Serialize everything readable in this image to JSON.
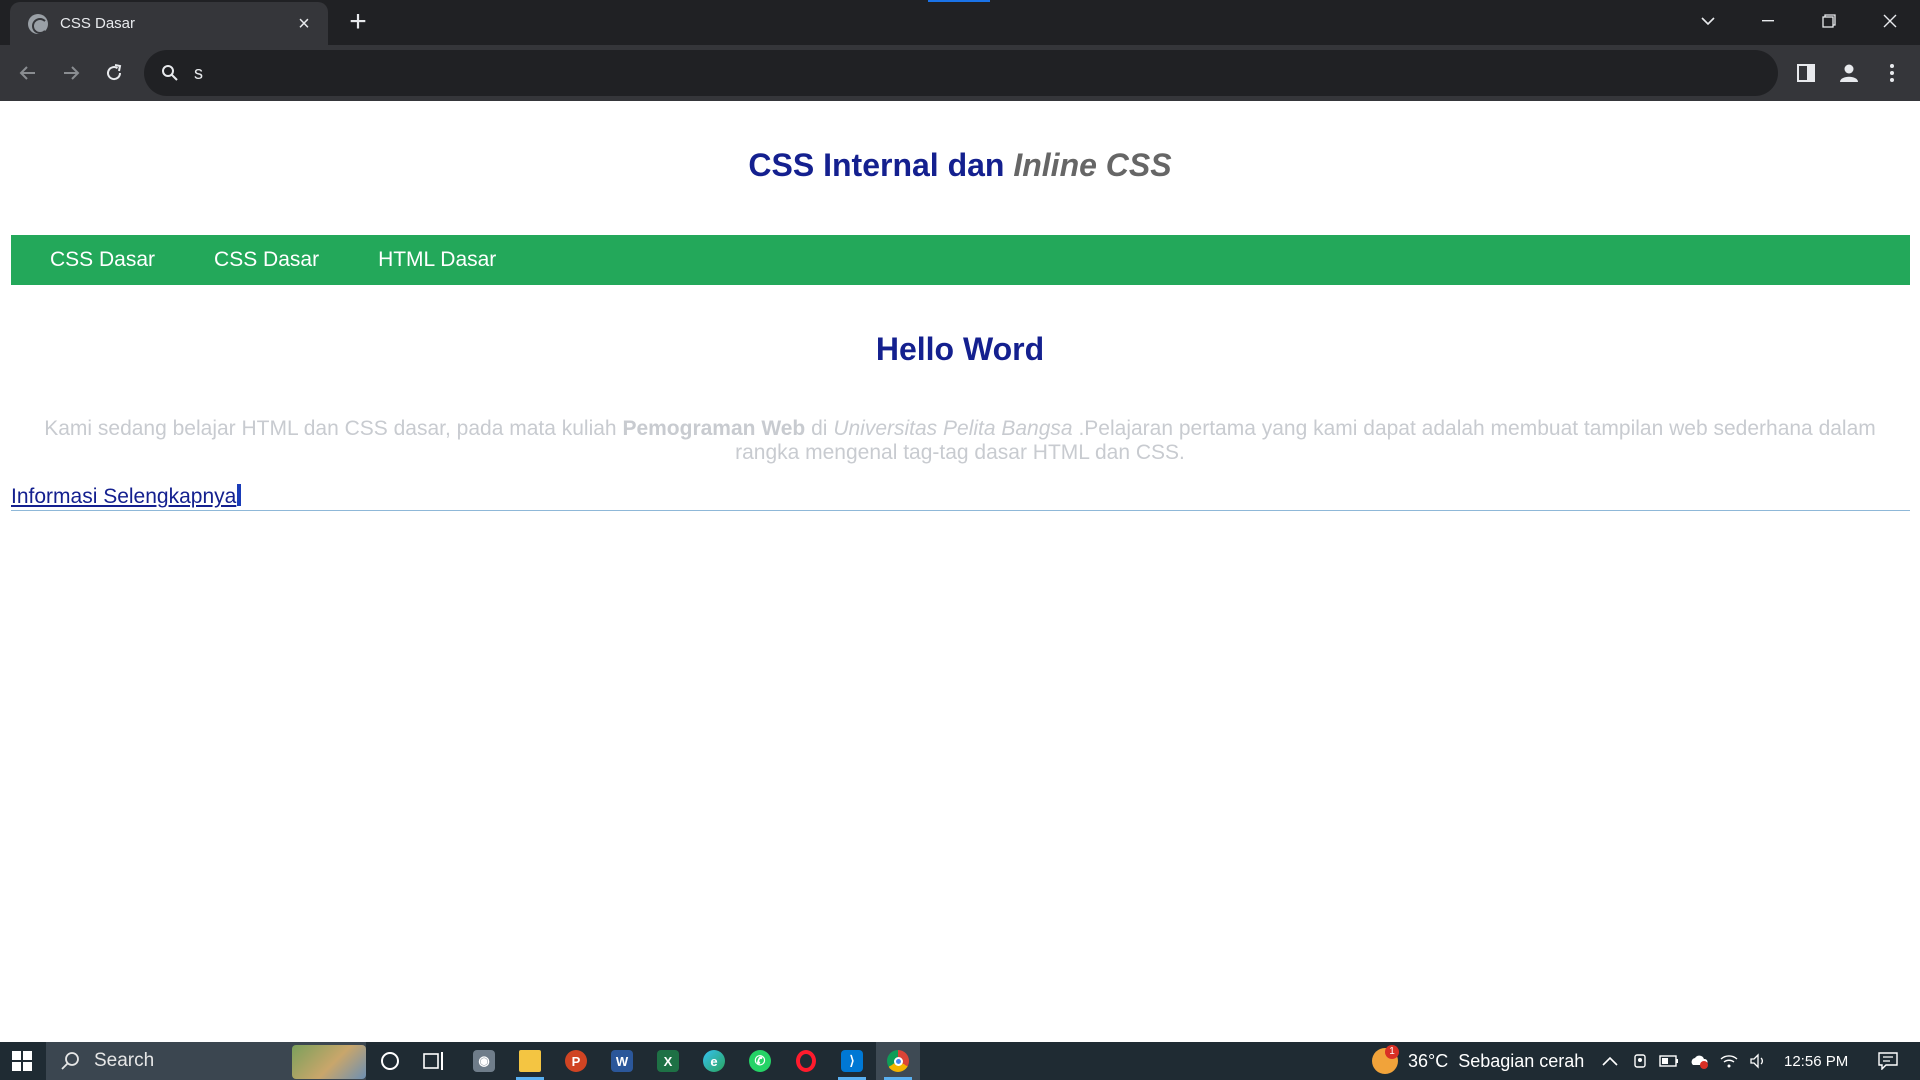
{
  "browser": {
    "tab_title": "CSS Dasar",
    "address": "s"
  },
  "page": {
    "header_main": "CSS Internal dan",
    "header_inline": "Inline CSS",
    "nav": [
      "CSS Dasar",
      "CSS Dasar",
      "HTML Dasar"
    ],
    "heading": "Hello Word",
    "paragraph": {
      "part1": "Kami sedang belajar HTML dan CSS dasar, pada mata kuliah",
      "bold": "Pemograman Web",
      "part2": "di",
      "italic": "Universitas Pelita Bangsa",
      "part3": ".Pelajaran pertama yang kami dapat adalah membuat tampilan web sederhana dalam rangka mengenal tag-tag dasar HTML dan CSS."
    },
    "link": "Informasi Selengkapnya",
    "colors": {
      "heading": "#14208f",
      "navbar": "#23a85a",
      "inline_text": "#666666",
      "paragraph": "#c8cbd0"
    }
  },
  "taskbar": {
    "search_placeholder": "Search",
    "apps": [
      "cortana",
      "task-view",
      "camera",
      "file-explorer",
      "powerpoint",
      "word",
      "excel",
      "edge",
      "whatsapp",
      "opera",
      "vscode",
      "chrome"
    ],
    "weather": {
      "temp": "36°C",
      "desc": "Sebagian cerah",
      "badge": "1"
    },
    "time": "12:56 PM"
  }
}
